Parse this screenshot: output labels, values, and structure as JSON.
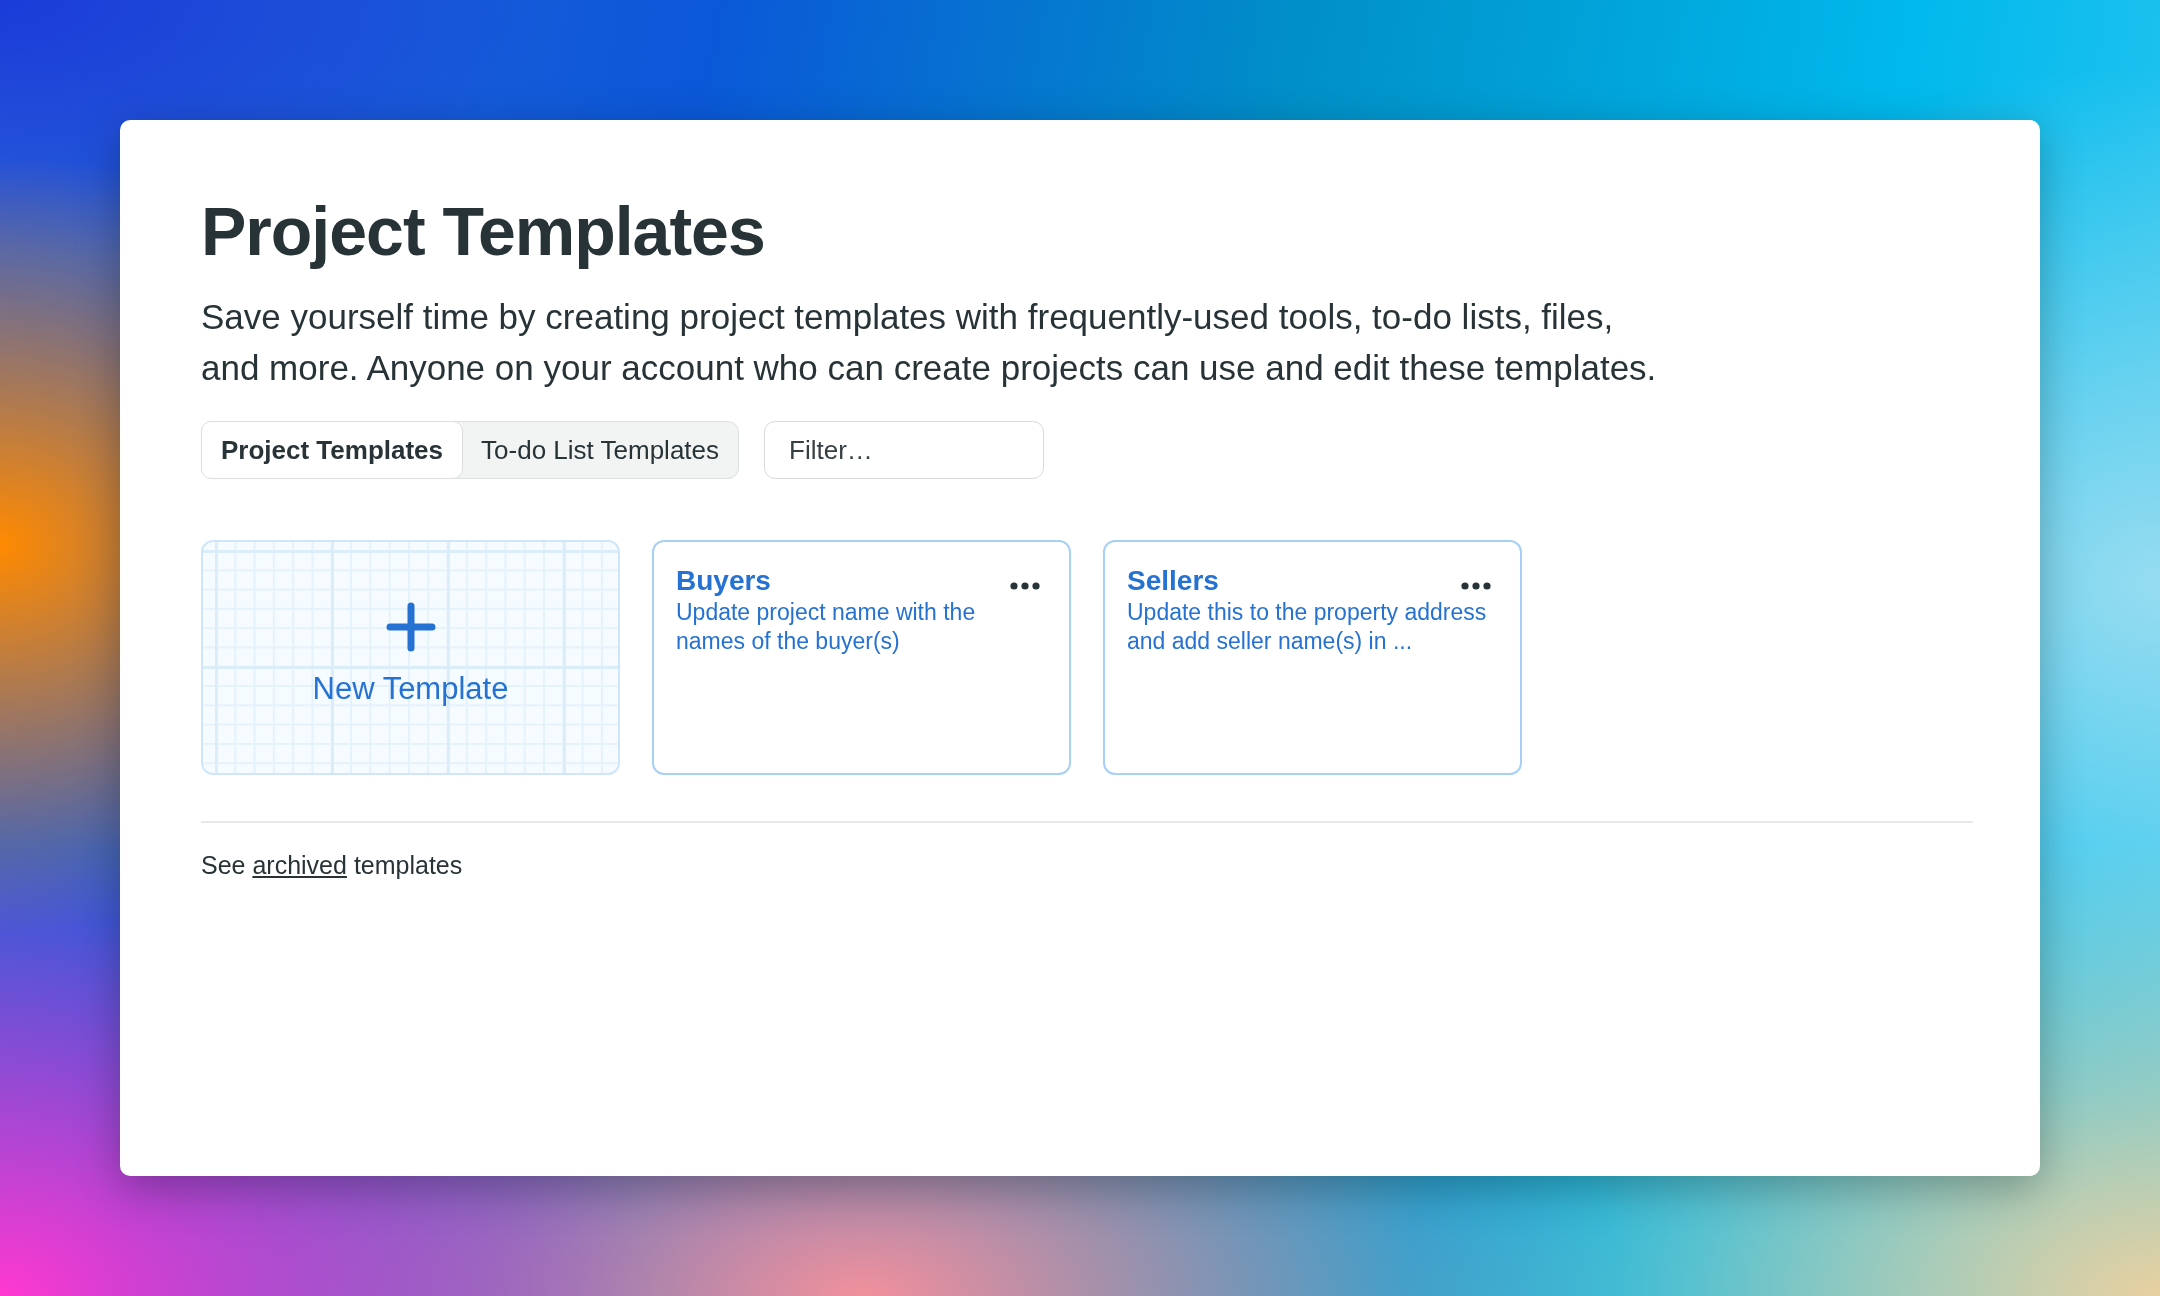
{
  "header": {
    "title": "Project Templates",
    "description": [
      "Save yourself time by creating project templates with frequently-used tools, to-do lists, files,",
      "and more. Anyone on your account who can create projects can use and edit these templates."
    ]
  },
  "tabs": [
    {
      "label": "Project Templates",
      "selected": true
    },
    {
      "label": "To-do List Templates",
      "selected": false
    }
  ],
  "filter": {
    "placeholder": "Filter…"
  },
  "new_template": {
    "label": "New Template"
  },
  "templates": [
    {
      "name": "Buyers",
      "description": "Update project name with the names of the buyer(s)"
    },
    {
      "name": "Sellers",
      "description": "Update this to the property address and add seller name(s) in ..."
    }
  ],
  "archived_note": {
    "before": "See",
    "link": "archived",
    "after": "templates"
  }
}
